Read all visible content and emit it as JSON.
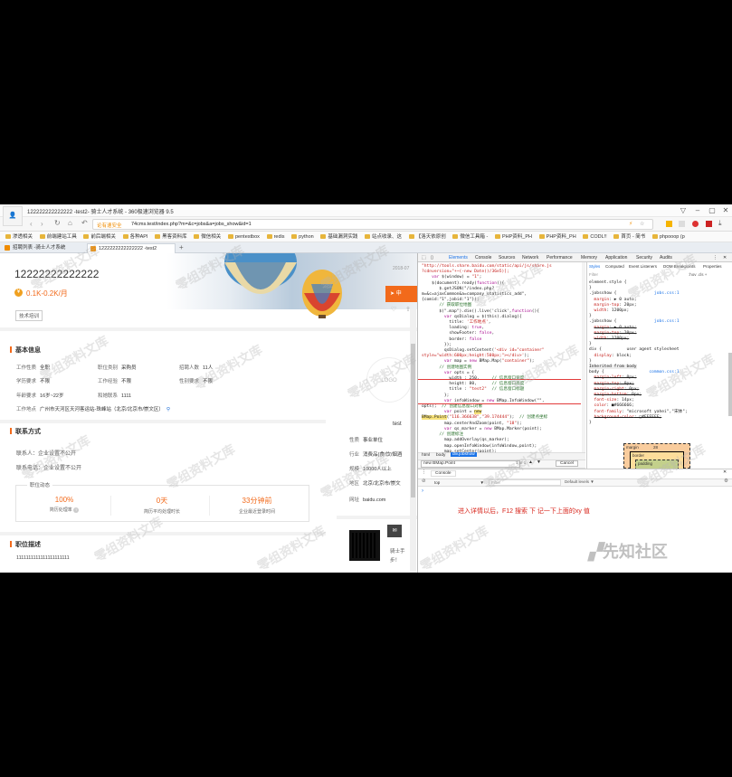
{
  "browser": {
    "window_title": "122222222222222 -test2- 骑士人才系统 - 360极速浏览器 9.5",
    "address_prefix": "论有速安全",
    "url": "74cms.test/index.php?m=&c=jobs&a=jobs_show&id=1",
    "bookmarks": [
      "渗透相关",
      "前端建站工具",
      "前后端相关",
      "各种API",
      "黑客资料库",
      "微信相关",
      "pentestbox",
      "redis",
      "python",
      "基础漏洞实践",
      "站点收录、这",
      "【洛天依原创",
      "微信工具箱 -",
      "PHP资料_PH",
      "PHP资料_PH",
      "CODL!!",
      "首页 - 简书",
      "phpooop (p"
    ],
    "tabs": [
      {
        "label": "招聘列表 -骑士人才系统",
        "active": false
      },
      {
        "label": "1222222222222222 -test2",
        "active": true
      }
    ]
  },
  "job": {
    "title": "12222222222222",
    "salary": "0.1K-0.2K/月",
    "tag": "技术培训",
    "date": "2018-07",
    "apply_label": "申",
    "basic_info_title": "基本信息",
    "fields": [
      {
        "label": "工作性质",
        "value": "全职"
      },
      {
        "label": "职位类别",
        "value": "采购员"
      },
      {
        "label": "招聘人数",
        "value": "11人"
      },
      {
        "label": "学历要求",
        "value": "不限"
      },
      {
        "label": "工作经验",
        "value": "不限"
      },
      {
        "label": "性别要求",
        "value": "不限"
      },
      {
        "label": "年龄要求",
        "value": "16岁~22岁"
      },
      {
        "label": "和她联系",
        "value": "1111"
      }
    ],
    "address_label": "工作地点",
    "address": "广州市天河区天河客运站-珠峰站（北京/北京市/崇文区）",
    "contact_title": "联系方式",
    "contact_person": "联系人：企业设置不公开",
    "contact_phone": "联系电话：企业设置不公开",
    "dynamics_title": "职位动态",
    "stats": [
      {
        "value": "100%",
        "label": "简历处理率"
      },
      {
        "value": "0天",
        "label": "简历平均处理时长"
      },
      {
        "value": "33分钟前",
        "label": "企业最近登录时间"
      }
    ],
    "desc_title": "职位描述",
    "desc_text": "1111111111111111111111"
  },
  "company": {
    "logo_text": "LOGO",
    "name": "test",
    "rows": [
      {
        "label": "性质",
        "value": "事业单位"
      },
      {
        "label": "行业",
        "value": "消费品(食/饮/烟酒"
      },
      {
        "label": "规模",
        "value": "10000人以上"
      },
      {
        "label": "地区",
        "value": "北京/北京市/崇文"
      },
      {
        "label": "网址",
        "value": "baidu.com"
      }
    ],
    "qr_note": "骑士手",
    "qr_sub": "步！"
  },
  "devtools": {
    "tabs": [
      "Elements",
      "Console",
      "Sources",
      "Network",
      "Performance",
      "Memory",
      "Application",
      "Security",
      "Audits"
    ],
    "style_tabs": [
      "Styles",
      "Computed",
      "Event Listeners",
      "DOM Breakpoints",
      "Properties"
    ],
    "filter_label": "Filter",
    "hov_label": ":hov .cls +",
    "breadcrumb": [
      "html",
      "body",
      "div.jobshow"
    ],
    "search_value": "new BMap.Point",
    "search_count": "1 of 1",
    "cancel_label": "Cancel",
    "console_tab": "Console",
    "console_context": "top",
    "console_filter": "Filter",
    "console_levels": "Default levels ▼",
    "annotation": "进入详情以后，F12 搜索 下 记一下上面的xy 值",
    "box_model_margin": "margin",
    "box_model_border": "border",
    "box_model_padding": "padding",
    "box_value": "28"
  },
  "watermark": "零组资料文库",
  "xianzhi": "先知社区"
}
